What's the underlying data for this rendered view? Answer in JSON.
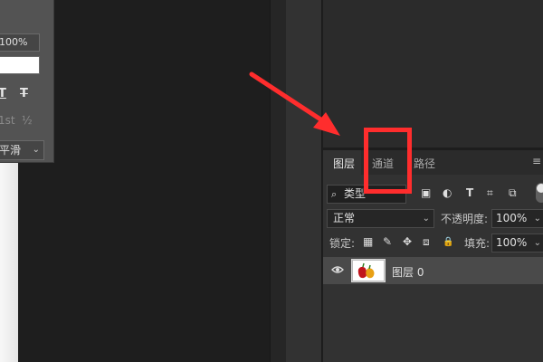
{
  "character_panel": {
    "percent_value": "100%",
    "style_buttons": [
      "T",
      "T"
    ],
    "fraction_buttons": [
      "1st",
      "½"
    ],
    "antialias_value": "平滑"
  },
  "layers_panel": {
    "tabs": [
      {
        "label": "图层",
        "active": true
      },
      {
        "label": "通道",
        "active": false
      },
      {
        "label": "路径",
        "active": false
      }
    ],
    "filter_kind": "类型",
    "blend_mode": "正常",
    "opacity_label": "不透明度:",
    "opacity_value": "100%",
    "lock_label": "锁定:",
    "fill_label": "填充:",
    "fill_value": "100%",
    "layers": [
      {
        "name": "图层 0",
        "visible": true
      }
    ]
  },
  "annotation": {
    "highlight_color": "#ff2d2d",
    "highlighted": "通道"
  },
  "icons": {
    "panel_menu": "≡",
    "search": "⌕",
    "filter_image": "▣",
    "filter_adjust": "◐",
    "filter_type": "T",
    "filter_shape": "⌗",
    "filter_smart": "⧉",
    "lock_pixels": "▦",
    "lock_paint": "✎",
    "lock_move": "✥",
    "lock_artboard": "⧈",
    "lock_all": "🔒",
    "eye": "👁"
  }
}
